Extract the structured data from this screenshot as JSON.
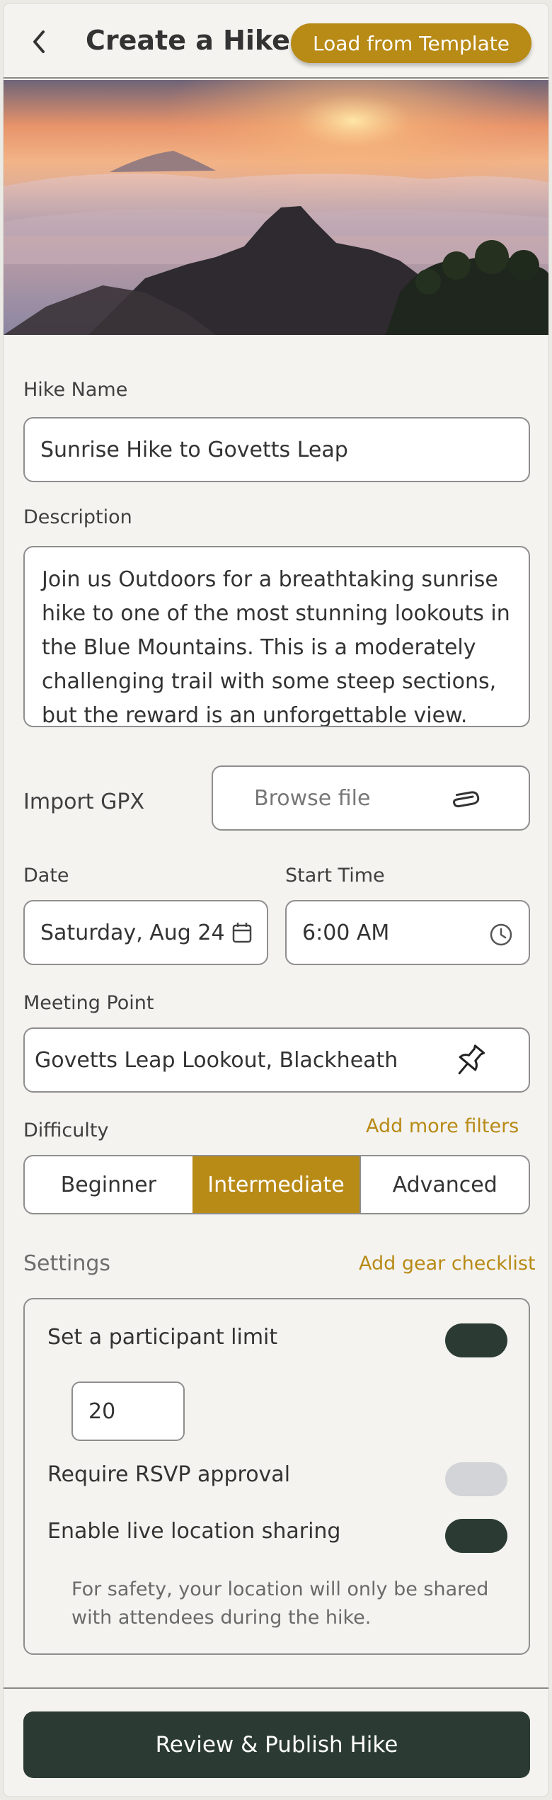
{
  "header": {
    "title": "Create a Hike",
    "template_button": "Load from Template"
  },
  "hero": {
    "image": "misty-mountain-sunrise"
  },
  "form": {
    "name_label": "Hike Name",
    "name_value": "Sunrise Hike to Govetts Leap",
    "description_label": "Description",
    "description_value": "Join us Outdoors for a breathtaking sunrise hike to one of the most stunning lookouts in the Blue Mountains. This is a moderately challenging trail with some steep sections, but the reward is an unforgettable view. We'll",
    "gpx_label": "Import GPX",
    "gpx_button": "Browse file",
    "date_label": "Date",
    "date_value": "Saturday, Aug 24",
    "time_label": "Start Time",
    "time_value": "6:00 AM",
    "meeting_label": "Meeting Point",
    "meeting_value": "Govetts Leap Lookout, Blackheath",
    "difficulty_label": "Difficulty",
    "filters_link": "Add more filters",
    "difficulty_options": [
      "Beginner",
      "Intermediate",
      "Advanced"
    ],
    "difficulty_selected": "Intermediate"
  },
  "settings": {
    "title": "Settings",
    "gear_link": "Add gear checklist",
    "participant_limit_label": "Set a participant limit",
    "participant_limit_on": true,
    "participant_limit_value": "20",
    "rsvp_label": "Require RSVP approval",
    "rsvp_on": false,
    "location_label": "Enable live location sharing",
    "location_on": true,
    "note": "For safety, your location will only be shared with attendees during the hike."
  },
  "footer": {
    "publish_button": "Review & Publish Hike"
  },
  "colors": {
    "accent": "#b88a16",
    "primary_dark": "#2b3b33",
    "toggle_off": "#d2d4d8",
    "background": "#f4f3ef"
  }
}
